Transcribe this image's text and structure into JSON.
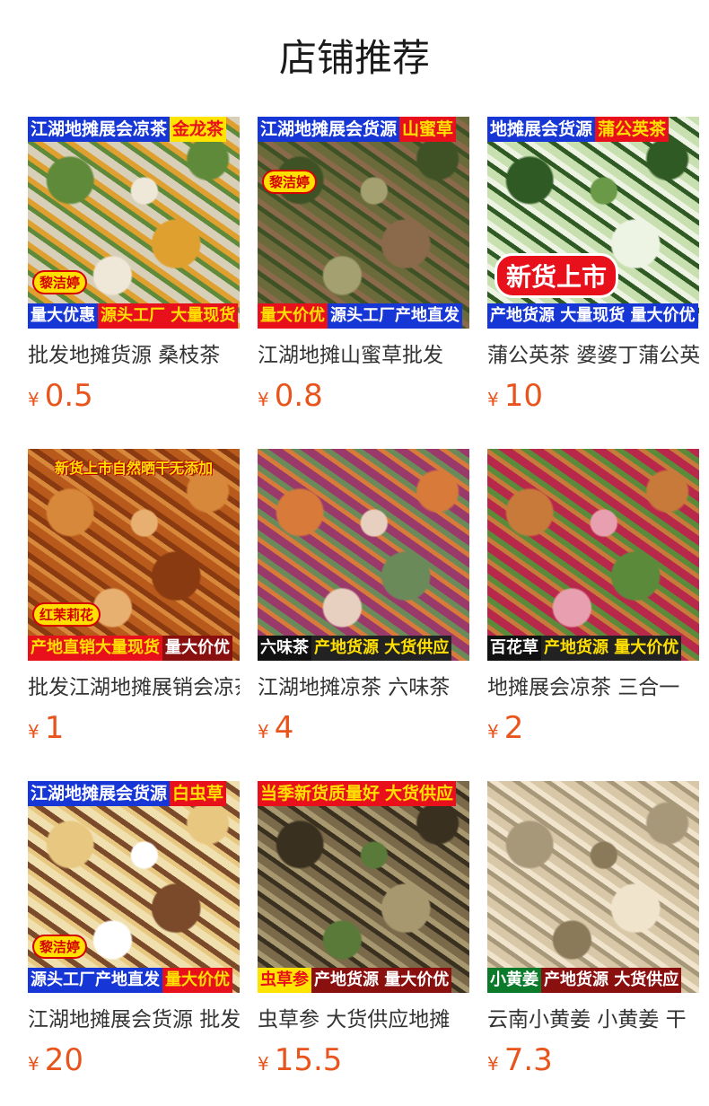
{
  "section_title": "店铺推荐",
  "currency_symbol": "¥",
  "products": [
    {
      "name": "批发地摊货源 桑枝茶",
      "price": "0.5",
      "image": {
        "top": [
          {
            "text": "江湖地摊展会凉茶",
            "style": "seg-blue"
          },
          {
            "text": "金龙茶",
            "style": "seg-yellow"
          }
        ],
        "bottom": [
          {
            "text": "量大优惠",
            "style": "seg-blue"
          },
          {
            "text": "源头工厂 大量现货",
            "style": "seg-red"
          }
        ],
        "stamp": "黎洁婷",
        "palette": [
          "#d8cfb8",
          "#5f8a3a",
          "#e0a030",
          "#efe8d8"
        ]
      }
    },
    {
      "name": "江湖地摊山蜜草批发",
      "price": "0.8",
      "image": {
        "top": [
          {
            "text": "江湖地摊展会货源",
            "style": "seg-blue"
          },
          {
            "text": "山蜜草",
            "style": "seg-red"
          }
        ],
        "bottom": [
          {
            "text": "量大价优",
            "style": "seg-red"
          },
          {
            "text": "源头工厂产地直发",
            "style": "seg-blue"
          }
        ],
        "stamp": "黎洁婷",
        "palette": [
          "#6a6a3a",
          "#3e5226",
          "#8a6a4a",
          "#a4a070"
        ]
      }
    },
    {
      "name": "蒲公英茶 婆婆丁蒲公英",
      "price": "10",
      "image": {
        "top": [
          {
            "text": "地摊展会货源",
            "style": "seg-blue"
          },
          {
            "text": "蒲公英茶",
            "style": "seg-red"
          }
        ],
        "bottom": [
          {
            "text": "产地货源 大量现货 量大价优",
            "style": "seg-blue"
          }
        ],
        "badge": "新货上市",
        "palette": [
          "#c8e0b0",
          "#2f5a24",
          "#eef4e4",
          "#6a9a48"
        ]
      }
    },
    {
      "name": "批发江湖地摊展销会凉茶",
      "price": "1",
      "image": {
        "top": [],
        "float": "新货上市自然晒干无添加",
        "bottom": [
          {
            "text": "产地直销大量现货",
            "style": "seg-red"
          },
          {
            "text": "量大价优",
            "style": "seg-darkred"
          }
        ],
        "stamp": "红茉莉花",
        "palette": [
          "#b85a1c",
          "#d8883a",
          "#8a3a10",
          "#e8b070"
        ]
      }
    },
    {
      "name": "江湖地摊凉茶 六味茶",
      "price": "4",
      "image": {
        "top": [],
        "bottom": [
          {
            "text": "六味茶",
            "style": "seg-black"
          },
          {
            "text": "产地货源 大货供应",
            "style": "seg-dark"
          }
        ],
        "palette": [
          "#9a3a6a",
          "#d87a3a",
          "#6a8a5a",
          "#e8d0c0"
        ]
      }
    },
    {
      "name": "地摊展会凉茶 三合一",
      "price": "2",
      "image": {
        "top": [],
        "bottom": [
          {
            "text": "百花草",
            "style": "seg-black"
          },
          {
            "text": "产地货源 量大价优",
            "style": "seg-dark"
          }
        ],
        "palette": [
          "#b8284a",
          "#c87a3a",
          "#5a8a3a",
          "#e8a0b0"
        ]
      }
    },
    {
      "name": "江湖地摊展会货源 批发",
      "price": "20",
      "image": {
        "top": [
          {
            "text": "江湖地摊展会货源",
            "style": "seg-blue"
          },
          {
            "text": "白虫草",
            "style": "seg-red"
          }
        ],
        "bottom": [
          {
            "text": "源头工厂产地直发",
            "style": "seg-blue"
          },
          {
            "text": "量大价优",
            "style": "seg-red"
          }
        ],
        "stamp": "黎洁婷",
        "palette": [
          "#f0e0b0",
          "#e8c880",
          "#7a4a2a",
          "#ffffff"
        ]
      }
    },
    {
      "name": "虫草参 大货供应地摊",
      "price": "15.5",
      "image": {
        "top": [
          {
            "text": "当季新货质量好",
            "style": "seg-red"
          },
          {
            "text": "大货供应",
            "style": "seg-red"
          }
        ],
        "bottom": [
          {
            "text": "虫草参",
            "style": "seg-yellow"
          },
          {
            "text": "产地货源 量大价优",
            "style": "seg-darkred"
          }
        ],
        "palette": [
          "#7a6a4a",
          "#3a3020",
          "#a89870",
          "#5a7a3a"
        ]
      }
    },
    {
      "name": "云南小黄姜 小黄姜 干",
      "price": "7.3",
      "image": {
        "top": [],
        "bottom": [
          {
            "text": "小黄姜",
            "style": "seg-green"
          },
          {
            "text": "产地货源 大货供应",
            "style": "seg-darkred"
          }
        ],
        "palette": [
          "#d8c8a8",
          "#a8987a",
          "#f0e4cc",
          "#8a7a5a"
        ]
      }
    }
  ]
}
